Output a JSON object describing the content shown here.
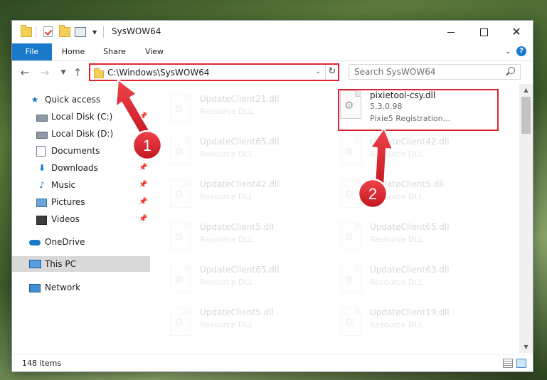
{
  "window": {
    "title": "SysWOW64",
    "icons": [
      "folder-icon",
      "properties-check-icon",
      "new-folder-icon",
      "customize-icon"
    ]
  },
  "ribbon": {
    "tabs": [
      "File",
      "Home",
      "Share",
      "View"
    ],
    "help": "?"
  },
  "navigation": {
    "address": "C:\\Windows\\SysWOW64",
    "search_placeholder": "Search SysWOW64"
  },
  "sidebar": {
    "items": [
      {
        "label": "Quick access",
        "icon": "star-icon"
      },
      {
        "label": "Local Disk (C:)",
        "icon": "disk-icon"
      },
      {
        "label": "Local Disk (D:)",
        "icon": "disk-icon"
      },
      {
        "label": "Documents",
        "icon": "documents-icon"
      },
      {
        "label": "Downloads",
        "icon": "downloads-icon"
      },
      {
        "label": "Music",
        "icon": "music-icon"
      },
      {
        "label": "Pictures",
        "icon": "pictures-icon"
      },
      {
        "label": "Videos",
        "icon": "videos-icon"
      },
      {
        "label": "OneDrive",
        "icon": "onedrive-icon"
      },
      {
        "label": "This PC",
        "icon": "this-pc-icon"
      },
      {
        "label": "Network",
        "icon": "network-icon"
      }
    ]
  },
  "files": {
    "column_left": [
      {
        "name": "UpdateClient21.dll",
        "type": "Resource DLL"
      },
      {
        "name": "UpdateClient65.dll",
        "type": "Resource DLL"
      },
      {
        "name": "UpdateClient42.dll",
        "type": "Resource DLL"
      },
      {
        "name": "UpdateClient5.dll",
        "type": "Resource DLL"
      },
      {
        "name": "UpdateClient65.dll",
        "type": "Resource DLL"
      },
      {
        "name": "UpdateClient5.dll",
        "type": "Resource DLL"
      }
    ],
    "column_right": [
      {
        "name": "pixietool-csy.dll",
        "version": "5.3.0.98",
        "type": "Pixie5 Registration..."
      },
      {
        "name": "UpdateClient42.dll",
        "type": "Resource DLL"
      },
      {
        "name": "UpdateClient5.dll",
        "type": "Resource DLL"
      },
      {
        "name": "UpdateClient65.dll",
        "type": "Resource DLL"
      },
      {
        "name": "UpdateClient63.dll",
        "type": "Resource DLL"
      },
      {
        "name": "UpdateClient19.dll",
        "type": "Resource DLL"
      }
    ]
  },
  "status": {
    "item_count": "148 items"
  },
  "annotations": {
    "step1": "1",
    "step2": "2",
    "color": "#e0232f"
  }
}
